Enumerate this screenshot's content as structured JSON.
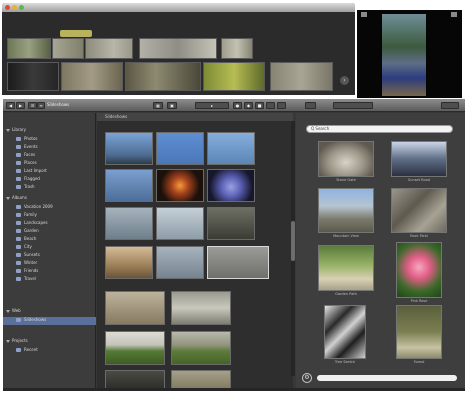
{
  "top_window": {
    "title": "",
    "tag_label": "",
    "next_arrow": "›"
  },
  "toolbar": {
    "path_label": "Slideshows",
    "buttons": [
      "◀",
      "▶",
      "☰",
      "≡",
      "▦",
      "▣",
      "▸",
      "●",
      "◆",
      "■"
    ]
  },
  "sidebar": {
    "items": [
      {
        "label": "Library",
        "level": 0,
        "open": true
      },
      {
        "label": "Photos",
        "level": 1
      },
      {
        "label": "Events",
        "level": 1
      },
      {
        "label": "Faces",
        "level": 1
      },
      {
        "label": "Places",
        "level": 1
      },
      {
        "label": "Last Import",
        "level": 1
      },
      {
        "label": "Flagged",
        "level": 1
      },
      {
        "label": "Trash",
        "level": 1
      },
      {
        "label": "Albums",
        "level": 0,
        "open": true
      },
      {
        "label": "Vacation 2009",
        "level": 1
      },
      {
        "label": "Family",
        "level": 1
      },
      {
        "label": "Landscapes",
        "level": 1
      },
      {
        "label": "Garden",
        "level": 1
      },
      {
        "label": "Beach",
        "level": 1
      },
      {
        "label": "City",
        "level": 1
      },
      {
        "label": "Sunsets",
        "level": 1
      },
      {
        "label": "Winter",
        "level": 1
      },
      {
        "label": "Friends",
        "level": 1
      },
      {
        "label": "Travel",
        "level": 1
      },
      {
        "label": "Web",
        "level": 0,
        "open": true
      },
      {
        "label": "Slideshows",
        "level": 1,
        "selected": true
      },
      {
        "label": "Projects",
        "level": 0,
        "open": true
      },
      {
        "label": "Recent",
        "level": 1
      }
    ]
  },
  "grid": {
    "path_text": "Slideshows"
  },
  "right_panel": {
    "search_placeholder": "Q Search",
    "captions": [
      "Stone Gate",
      "Sunset Road",
      "Mountain View",
      "Rock Field",
      "Garden Path",
      "Pink Rose",
      "Tree Sketch",
      "Forest"
    ],
    "gear": "⚙"
  },
  "colors": {
    "selection": "#5a6f99",
    "sidebar_icon": "#8ea0c8",
    "accent_tag": "#b9b25d"
  }
}
